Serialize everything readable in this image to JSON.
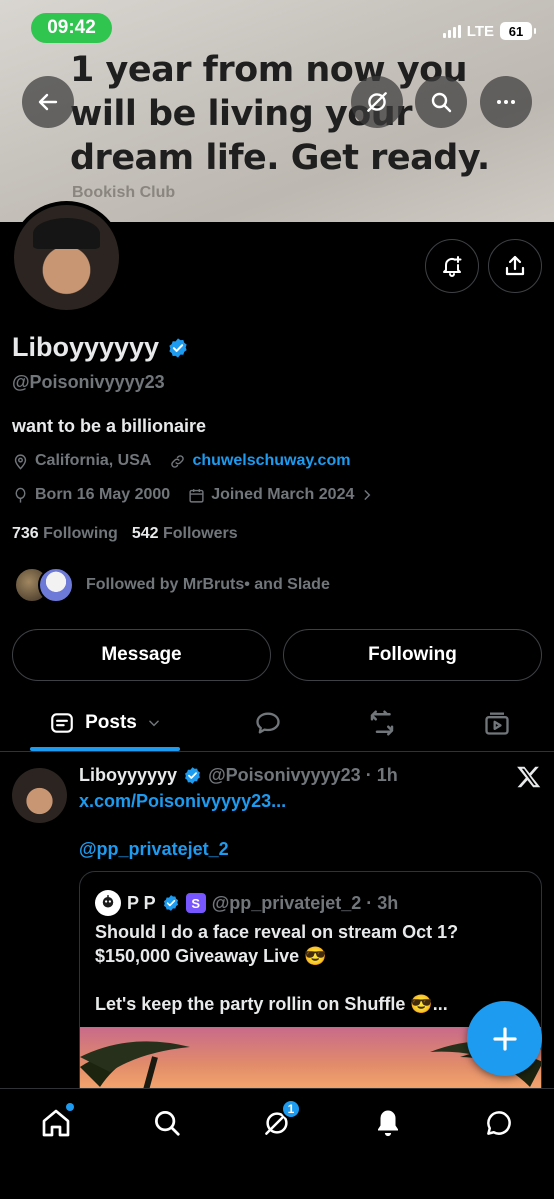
{
  "status_bar": {
    "time": "09:42",
    "network": "LTE",
    "battery": "61"
  },
  "banner": {
    "quote": "1 year from now you will be living your dream life. Get ready.",
    "credit": "Bookish Club"
  },
  "profile": {
    "name": "Liboyyyyyy",
    "handle": "@Poisonivyyyy23",
    "bio": "want to be a billionaire",
    "location": "California, USA",
    "website": "chuwelschuway.com",
    "born": "Born 16 May 2000",
    "joined": "Joined March 2024",
    "following_count": "736",
    "following_label": "Following",
    "followers_count": "542",
    "followers_label": "Followers",
    "followed_by": "Followed by MrBruts• and Slade"
  },
  "actions": {
    "message": "Message",
    "following": "Following"
  },
  "tabs": {
    "posts": "Posts"
  },
  "post": {
    "name": "Liboyyyyyy",
    "handle_time": "@Poisonivyyyy23 · 1h",
    "link": "x.com/Poisonivyyyy23...",
    "mention": "@pp_privatejet_2",
    "quote": {
      "name": "P P",
      "handle_time": "@pp_privatejet_2 · 3h",
      "badge": "S",
      "text_line1": "Should I do a face reveal on stream Oct 1?",
      "text_line2": "$150,000 Giveaway Live 😎",
      "text_line3": "Let's keep the party rollin on Shuffle 😎..."
    }
  },
  "nav": {
    "messages_badge": "1"
  },
  "colors": {
    "accent": "#1d9bf0",
    "background": "#000000",
    "muted": "#71767b"
  }
}
